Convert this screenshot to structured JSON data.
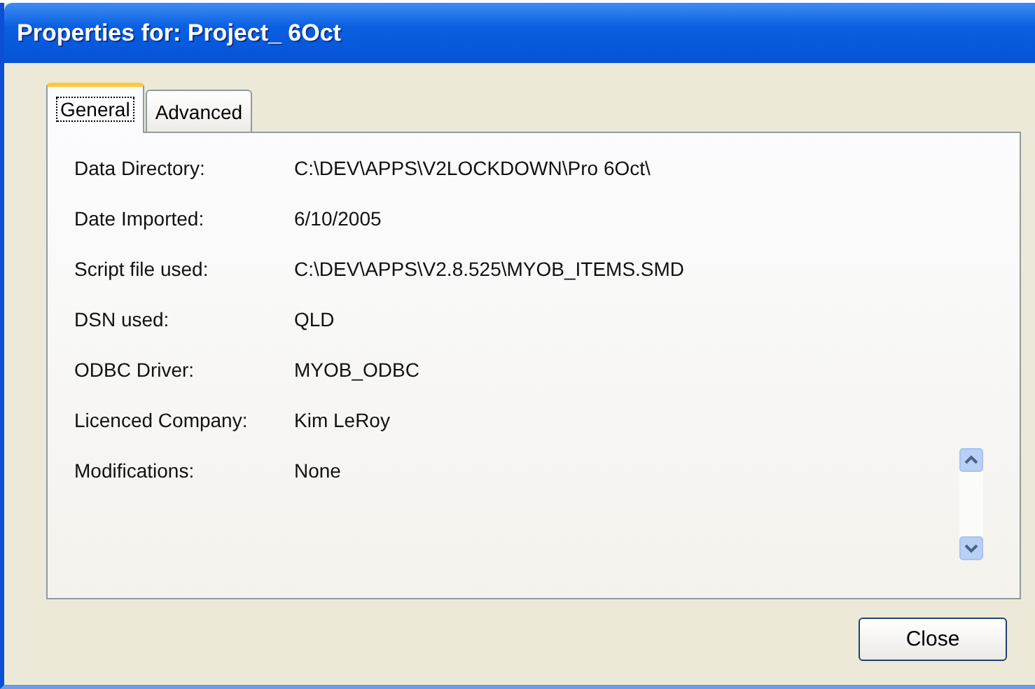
{
  "window": {
    "title": "Properties for: Project_ 6Oct"
  },
  "tabs": [
    {
      "label": "General",
      "selected": true
    },
    {
      "label": "Advanced",
      "selected": false
    }
  ],
  "properties": [
    {
      "label": "Data Directory:",
      "value": "C:\\DEV\\APPS\\V2LOCKDOWN\\Pro 6Oct\\"
    },
    {
      "label": "Date Imported:",
      "value": "6/10/2005"
    },
    {
      "label": "Script file used:",
      "value": "C:\\DEV\\APPS\\V2.8.525\\MYOB_ITEMS.SMD"
    },
    {
      "label": "DSN used:",
      "value": "QLD"
    },
    {
      "label": "ODBC Driver:",
      "value": "MYOB_ODBC"
    },
    {
      "label": "Licenced Company:",
      "value": "Kim LeRoy"
    }
  ],
  "modifications": {
    "label": "Modifications:",
    "value": "None"
  },
  "buttons": [
    "Close"
  ]
}
